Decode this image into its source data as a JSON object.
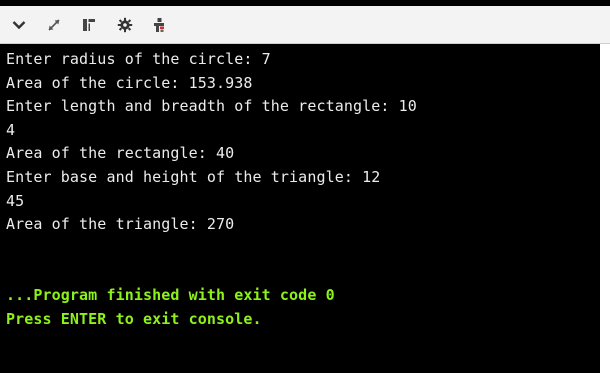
{
  "toolbar": {
    "buttons": [
      {
        "name": "chevron-down-icon"
      },
      {
        "name": "expand-icon"
      },
      {
        "name": "split-panel-icon"
      },
      {
        "name": "gear-icon"
      },
      {
        "name": "share-icon"
      }
    ]
  },
  "console": {
    "lines": [
      "Enter radius of the circle: 7",
      "Area of the circle: 153.938",
      "Enter length and breadth of the rectangle: 10",
      "4",
      "Area of the rectangle: 40",
      "Enter base and height of the triangle: 12",
      "45",
      "Area of the triangle: 270",
      "",
      "",
      "...Program finished with exit code 0",
      "Press ENTER to exit console."
    ],
    "text_color": "#ececec",
    "success_color": "#8df11a",
    "background": "#000000"
  }
}
